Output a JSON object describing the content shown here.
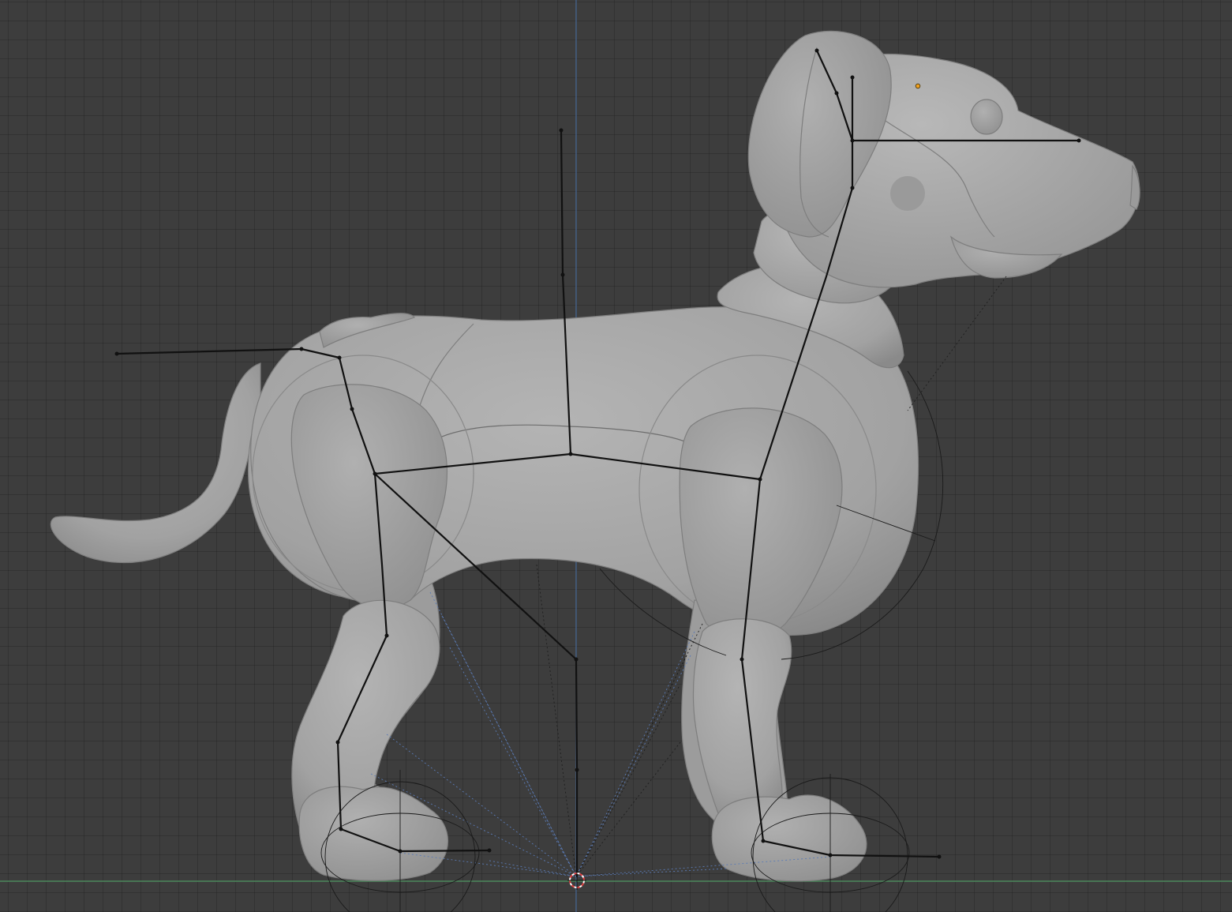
{
  "viewport": {
    "background": "#3d3d3d",
    "grid_line_color": "#333333",
    "axis_y_color": "#4a6a9a",
    "axis_x_color": "#4c8a5c"
  },
  "model": {
    "subject": "robot-dog",
    "surface_color": "#a8a8a8",
    "shadow_color": "#8a8a8a"
  },
  "armature": {
    "bone_color": "#111111",
    "relationship_line_color": "#1e1e1e",
    "ik_line_color": "#5a7ab4",
    "control_circle_color": "#1a1a1a"
  },
  "markers": {
    "cursor_icon": "3d-cursor-icon",
    "cursor_colors": [
      "#e04040",
      "#ffffff"
    ],
    "selected_vertex_color": "#f0a020"
  }
}
